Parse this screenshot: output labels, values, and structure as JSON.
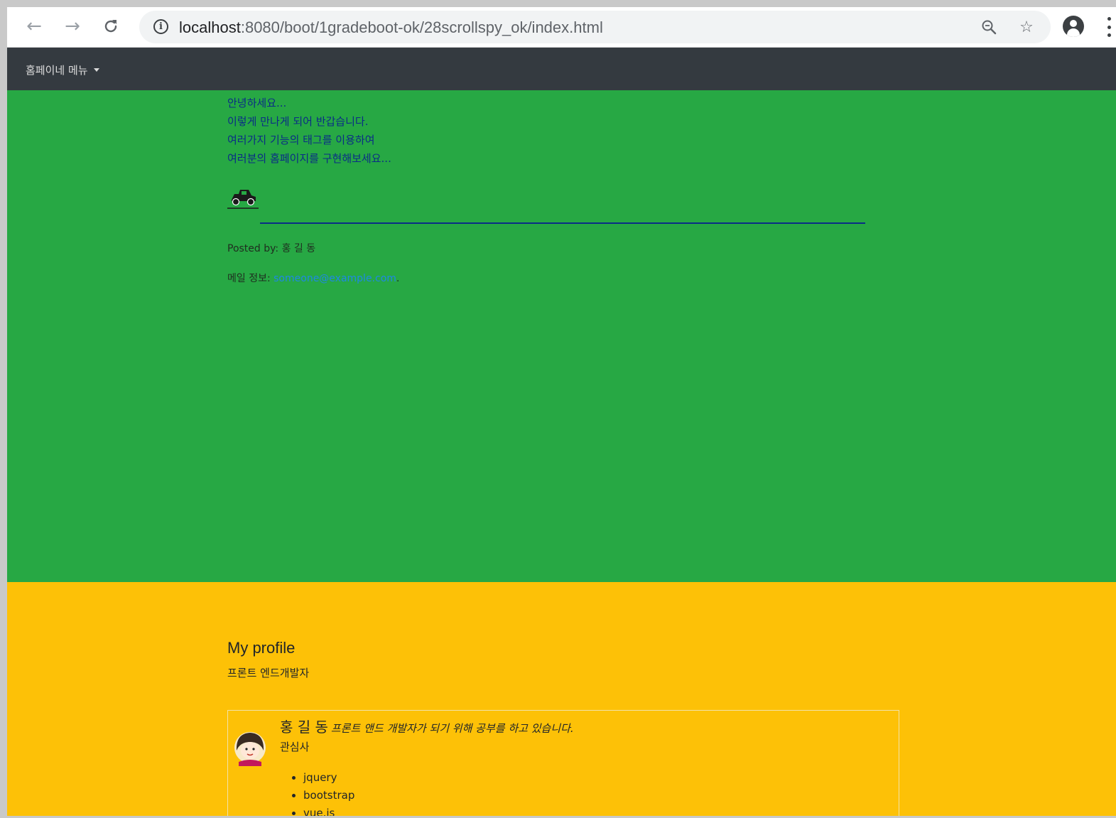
{
  "browser": {
    "url_host": "localhost",
    "url_rest": ":8080/boot/1gradeboot-ok/28scrollspy_ok/index.html"
  },
  "navbar": {
    "menu_label": "홈페이네 메뉴"
  },
  "intro": {
    "lines": [
      "안녕하세요...",
      "이렇게 만나게 되어 반갑습니다.",
      "여러가지 기능의 태그를 이용하여",
      "여러분의 홈페이지를 구현해보세요..."
    ]
  },
  "post": {
    "posted_by_label": "Posted by:",
    "posted_by_name": "홍 길 동",
    "mail_label": "메일 정보:",
    "mail_link": "someone@example.com",
    "mail_suffix": "."
  },
  "profile": {
    "title": "My profile",
    "subtitle": "프론트 엔드개발자",
    "name": "홍 길 동",
    "description": "프론트 앤드 개발자가 되기 위해 공부를 하고 있습니다.",
    "interests_label": "관심사",
    "interests": [
      "jquery",
      "bootstrap",
      "vue.js"
    ]
  },
  "colors": {
    "green_section": "#27a844",
    "yellow_section": "#fdc107",
    "navbar": "#343a40",
    "intro_text": "#0a2c86",
    "link": "#1e88e5"
  },
  "icons": {
    "car": "car-icon",
    "avatar": "avatar-image"
  }
}
